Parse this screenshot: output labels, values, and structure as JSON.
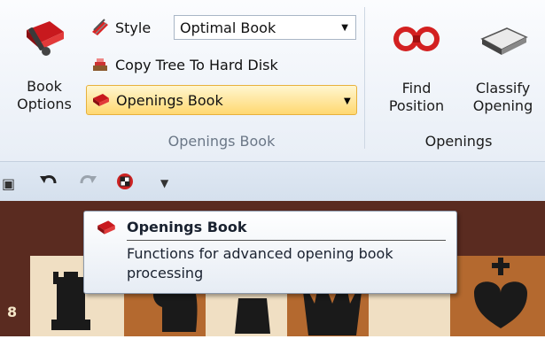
{
  "ribbon": {
    "book_options": {
      "label": "Book\nOptions",
      "icon": "book-options-icon"
    },
    "style": {
      "label": "Style",
      "value": "Optimal Book",
      "icon": "style-icon"
    },
    "copy_tree": {
      "label": "Copy Tree To Hard Disk",
      "icon": "copy-tree-icon"
    },
    "openings_book": {
      "label": "Openings Book",
      "icon": "openings-book-icon"
    },
    "group_openings_book": "Openings Book",
    "find_position": {
      "label": "Find\nPosition",
      "icon": "find-position-icon"
    },
    "classify_opening": {
      "label": "Classify\nOpening",
      "icon": "classify-opening-icon"
    },
    "group_openings": "Openings"
  },
  "quick_access": [
    "save-icon",
    "undo-icon",
    "redo-icon",
    "engine-icon",
    "customize-icon"
  ],
  "tooltip": {
    "title": "Openings Book",
    "description": "Functions for advanced opening book processing"
  },
  "board": {
    "rank_label": "8"
  },
  "colors": {
    "accent": "#ffd871",
    "board_dark": "#5a2b20",
    "board_light": "#f0dfc3"
  }
}
